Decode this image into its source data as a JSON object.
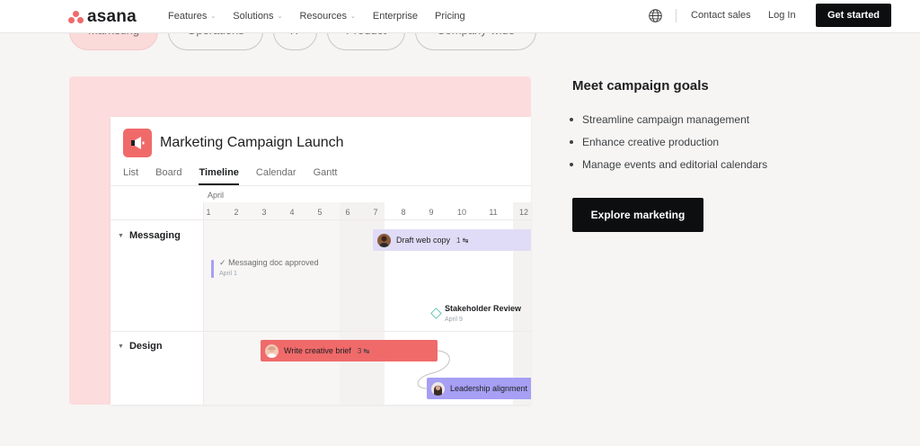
{
  "nav": {
    "logo_text": "asana",
    "links": [
      {
        "label": "Features",
        "has_dropdown": true
      },
      {
        "label": "Solutions",
        "has_dropdown": true
      },
      {
        "label": "Resources",
        "has_dropdown": true
      },
      {
        "label": "Enterprise",
        "has_dropdown": false
      },
      {
        "label": "Pricing",
        "has_dropdown": false
      }
    ],
    "contact_sales": "Contact sales",
    "log_in": "Log In",
    "get_started": "Get started",
    "language_icon": "globe-icon"
  },
  "pills": [
    "Marketing",
    "Operations",
    "IT",
    "Product",
    "Company-wide"
  ],
  "active_pill": "Marketing",
  "project": {
    "title": "Marketing Campaign Launch",
    "icon": "megaphone-icon",
    "tabs": [
      "List",
      "Board",
      "Timeline",
      "Calendar",
      "Gantt"
    ],
    "active_tab": "Timeline",
    "month": "April",
    "days": [
      "1",
      "2",
      "3",
      "4",
      "5",
      "6",
      "7",
      "8",
      "9",
      "10",
      "11",
      "12"
    ],
    "sections": [
      "Messaging",
      "Design"
    ],
    "tasks": {
      "draft_web_copy": {
        "label": "Draft web copy",
        "subtasks": "1"
      },
      "write_creative_brief": {
        "label": "Write creative brief",
        "subtasks": "3"
      },
      "leadership_alignment": {
        "label": "Leadership alignment"
      }
    },
    "completed_note": {
      "label": "Messaging doc approved",
      "date": "April 1"
    },
    "milestone": {
      "label": "Stakeholder Review",
      "date": "April 9"
    }
  },
  "copy": {
    "heading": "Meet campaign goals",
    "bullets": [
      "Streamline campaign management",
      "Enhance creative production",
      "Manage events and editorial calendars"
    ],
    "cta": "Explore marketing"
  },
  "colors": {
    "brand_coral": "#f06a6a",
    "promo_bg": "#fcdcdc",
    "cta_black": "#0d0e10",
    "lavender": "#e0dcf7",
    "violet": "#a69ff3",
    "milestone_teal": "#6bc7b6"
  }
}
